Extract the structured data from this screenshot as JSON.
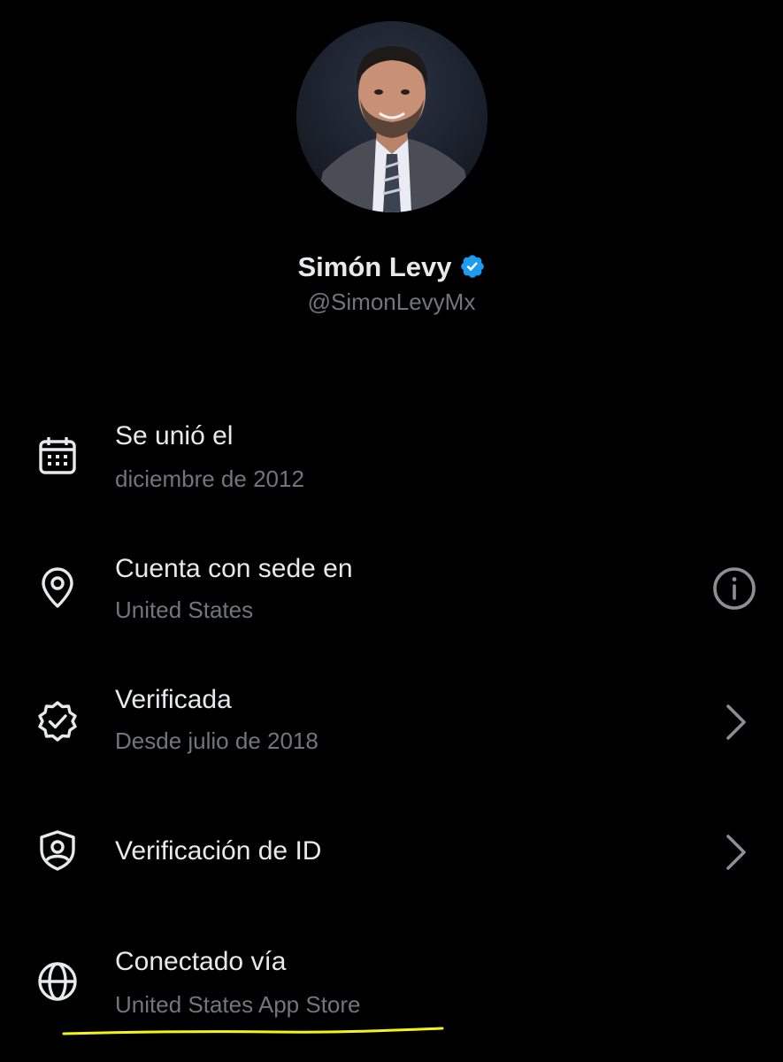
{
  "profile": {
    "name": "Simón Levy",
    "handle": "@SimonLevyMx",
    "verified_badge_icon": "verified-checkmark-icon",
    "badge_color": "#1d9bf0"
  },
  "about_items": [
    {
      "icon": "calendar-icon",
      "title": "Se unió el",
      "subtitle": "diciembre de 2012"
    },
    {
      "icon": "location-pin-icon",
      "title": "Cuenta con sede en",
      "subtitle": "United States",
      "trailing_icon": "info-icon"
    },
    {
      "icon": "verified-seal-icon",
      "title": "Verificada",
      "subtitle": "Desde julio de 2018",
      "trailing_icon": "chevron-right-icon"
    },
    {
      "icon": "id-shield-icon",
      "title": "Verificación de ID",
      "trailing_icon": "chevron-right-icon"
    },
    {
      "icon": "globe-icon",
      "title": "Conectado vía",
      "subtitle": "United States App Store"
    }
  ],
  "annotation": {
    "color": "#f5f514"
  },
  "colors": {
    "background": "#000000",
    "primary_text": "#e7e9ea",
    "secondary_text": "#71767b"
  }
}
